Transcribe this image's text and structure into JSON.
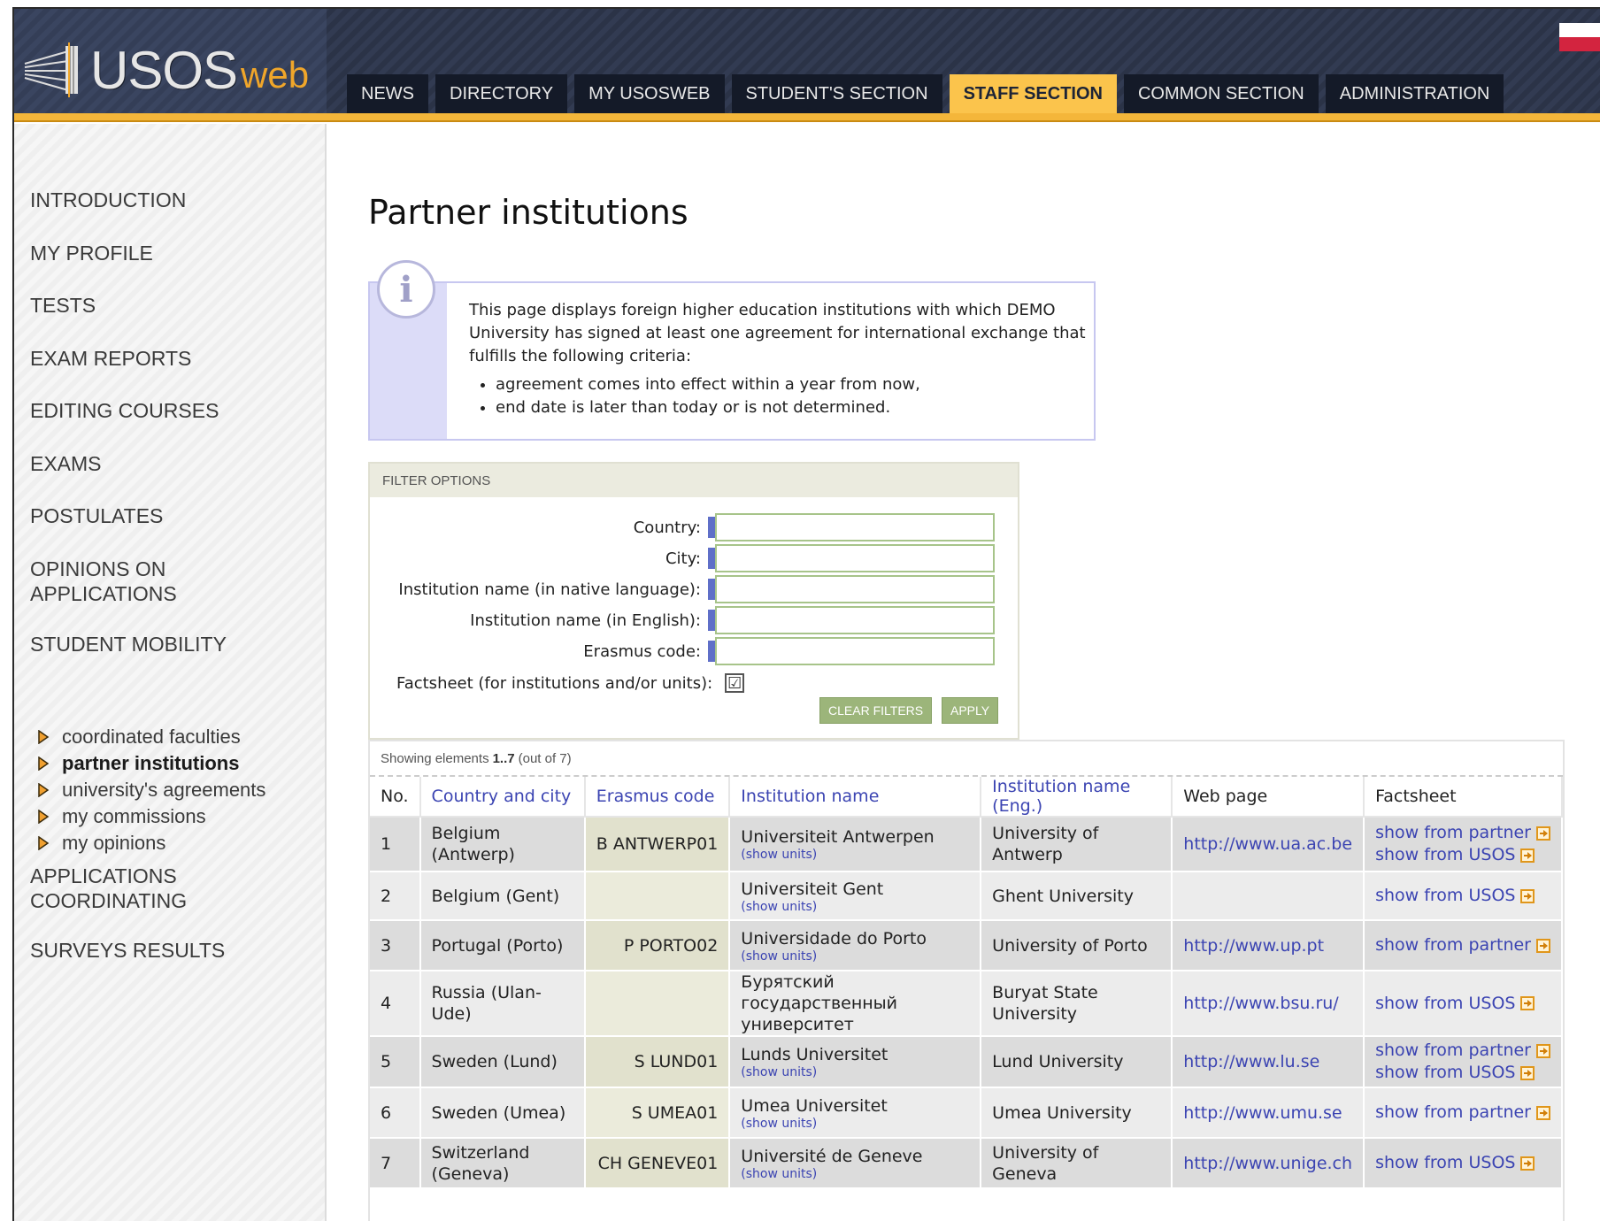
{
  "header": {
    "logo_main": "USOS",
    "logo_sub": "web",
    "tabs": [
      {
        "label": "NEWS"
      },
      {
        "label": "DIRECTORY"
      },
      {
        "label": "MY USOSWEB"
      },
      {
        "label": "STUDENT'S SECTION"
      },
      {
        "label": "STAFF SECTION"
      },
      {
        "label": "COMMON SECTION"
      },
      {
        "label": "ADMINISTRATION"
      }
    ],
    "active_tab": "STAFF SECTION"
  },
  "sidebar": {
    "items": [
      {
        "label": "INTRODUCTION"
      },
      {
        "label": "MY PROFILE"
      },
      {
        "label": "TESTS"
      },
      {
        "label": "EXAM REPORTS"
      },
      {
        "label": "EDITING COURSES"
      },
      {
        "label": "EXAMS"
      },
      {
        "label": "POSTULATES"
      },
      {
        "label": "OPINIONS ON APPLICATIONS"
      },
      {
        "label": "STUDENT MOBILITY"
      },
      {
        "label": "APPLICATIONS COORDINATING"
      },
      {
        "label": "SURVEYS RESULTS"
      }
    ],
    "sub_items": [
      {
        "label": "coordinated faculties"
      },
      {
        "label": "partner institutions"
      },
      {
        "label": "university's agreements"
      },
      {
        "label": "my commissions"
      },
      {
        "label": "my opinions"
      }
    ],
    "current_sub_item": "partner institutions"
  },
  "main": {
    "title": "Partner institutions",
    "info": {
      "icon": "i",
      "text": "This page displays foreign higher education institutions with which DEMO University has signed at least one agreement for international exchange that fulfills the following criteria:",
      "bullets": [
        "agreement comes into effect within a year from now,",
        "end date is later than today or is not determined."
      ]
    },
    "filters": {
      "heading": "FILTER OPTIONS",
      "info_icon": "i",
      "fields": [
        {
          "label": "Country:",
          "value": ""
        },
        {
          "label": "City:",
          "value": ""
        },
        {
          "label": "Institution name (in native language):",
          "value": ""
        },
        {
          "label": "Institution name (in English):",
          "value": ""
        },
        {
          "label": "Erasmus code:",
          "value": ""
        }
      ],
      "factsheet_label": "Factsheet (for institutions and/or units):",
      "factsheet_checked": "☑",
      "clear_label": "CLEAR FILTERS",
      "apply_label": "APPLY"
    },
    "results": {
      "showing_prefix": "Showing elements",
      "showing_range": "1..7",
      "showing_suffix": "(out of 7)",
      "columns": [
        "No.",
        "Country and city",
        "Erasmus code",
        "Institution name",
        "Institution name (Eng.)",
        "Web page",
        "Factsheet"
      ],
      "show_units_label": "(show units)",
      "rows": [
        {
          "no": "1",
          "country_city": "Belgium (Antwerp)",
          "erasmus": "B ANTWERP01",
          "name": "Universiteit Antwerpen",
          "show_units": true,
          "name_eng": "University of Antwerp",
          "web": "http://www.ua.ac.be",
          "factsheet": [
            "show from partner",
            "show from USOS"
          ]
        },
        {
          "no": "2",
          "country_city": "Belgium (Gent)",
          "erasmus": "",
          "name": "Universiteit Gent",
          "show_units": true,
          "name_eng": "Ghent University",
          "web": "",
          "factsheet": [
            "show from USOS"
          ]
        },
        {
          "no": "3",
          "country_city": "Portugal (Porto)",
          "erasmus": "P PORTO02",
          "name": "Universidade do Porto",
          "show_units": true,
          "name_eng": "University of Porto",
          "web": "http://www.up.pt",
          "factsheet": [
            "show from partner"
          ]
        },
        {
          "no": "4",
          "country_city": "Russia (Ulan-Ude)",
          "erasmus": "",
          "name": "Бурятский государственный университет",
          "show_units": false,
          "name_eng": "Buryat State University",
          "web": "http://www.bsu.ru/",
          "factsheet": [
            "show from USOS"
          ]
        },
        {
          "no": "5",
          "country_city": "Sweden (Lund)",
          "erasmus": "S LUND01",
          "name": "Lunds Universitet",
          "show_units": true,
          "name_eng": "Lund University",
          "web": "http://www.lu.se",
          "factsheet": [
            "show from partner",
            "show from USOS"
          ]
        },
        {
          "no": "6",
          "country_city": "Sweden (Umea)",
          "erasmus": "S UMEA01",
          "name": "Umea Universitet",
          "show_units": true,
          "name_eng": "Umea University",
          "web": "http://www.umu.se",
          "factsheet": [
            "show from partner"
          ]
        },
        {
          "no": "7",
          "country_city": "Switzerland (Geneva)",
          "erasmus": "CH GENEVE01",
          "name": "Université de Geneve",
          "show_units": true,
          "name_eng": "University of Geneva",
          "web": "http://www.unige.ch",
          "factsheet": [
            "show from USOS"
          ]
        }
      ]
    }
  },
  "colors": {
    "header_bg": "#2b3347",
    "accent": "#f4b63a",
    "active_tab": "#fbc44c",
    "link": "#3b44b2",
    "button": "#9cb57a"
  },
  "icons": [
    "usos-logo-icon",
    "flag-icon",
    "info-icon",
    "arrow-right-icon",
    "external-link-icon",
    "checkbox-icon"
  ]
}
